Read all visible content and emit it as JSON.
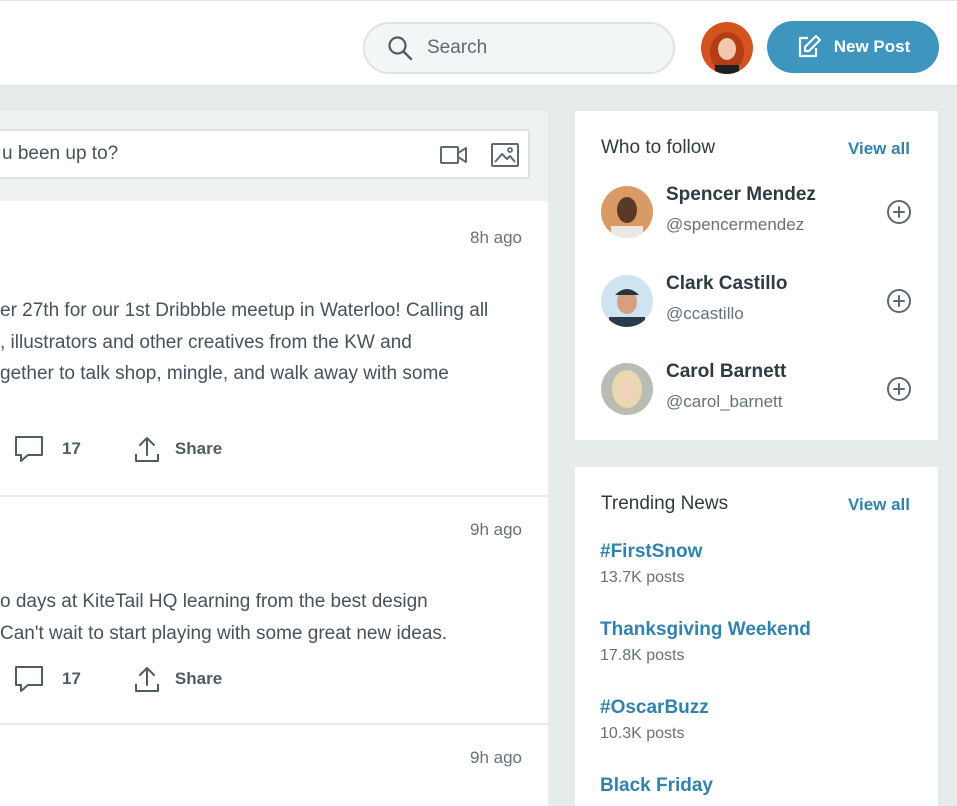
{
  "header": {
    "search_placeholder": "Search",
    "new_post_label": "New Post"
  },
  "composer": {
    "placeholder": "u been up to?"
  },
  "posts": [
    {
      "time": "8h ago",
      "lines": [
        "er 27th for our 1st Dribbble meetup in Waterloo! Calling all",
        ", illustrators and other creatives from the KW and",
        "gether to talk shop, mingle, and walk away with some"
      ],
      "comments": "17",
      "share_label": "Share"
    },
    {
      "time": "9h ago",
      "lines": [
        "o days at KiteTail HQ learning from the best design",
        "Can't wait to start playing with some great new ideas."
      ],
      "comments": "17",
      "share_label": "Share"
    },
    {
      "time": "9h ago"
    }
  ],
  "who_to_follow": {
    "title": "Who to follow",
    "view_all": "View all",
    "people": [
      {
        "name": "Spencer Mendez",
        "handle": "@spencermendez"
      },
      {
        "name": "Clark Castillo",
        "handle": "@ccastillo"
      },
      {
        "name": "Carol Barnett",
        "handle": "@carol_barnett"
      }
    ]
  },
  "trending": {
    "title": "Trending News",
    "view_all": "View all",
    "items": [
      {
        "tag": "#FirstSnow",
        "count": "13.7K posts"
      },
      {
        "tag": "Thanksgiving Weekend",
        "count": "17.8K posts"
      },
      {
        "tag": "#OscarBuzz",
        "count": "10.3K posts"
      },
      {
        "tag": "Black Friday"
      }
    ]
  },
  "colors": {
    "accent": "#3e95be",
    "link": "#3183ab",
    "background": "#e6ebec"
  }
}
